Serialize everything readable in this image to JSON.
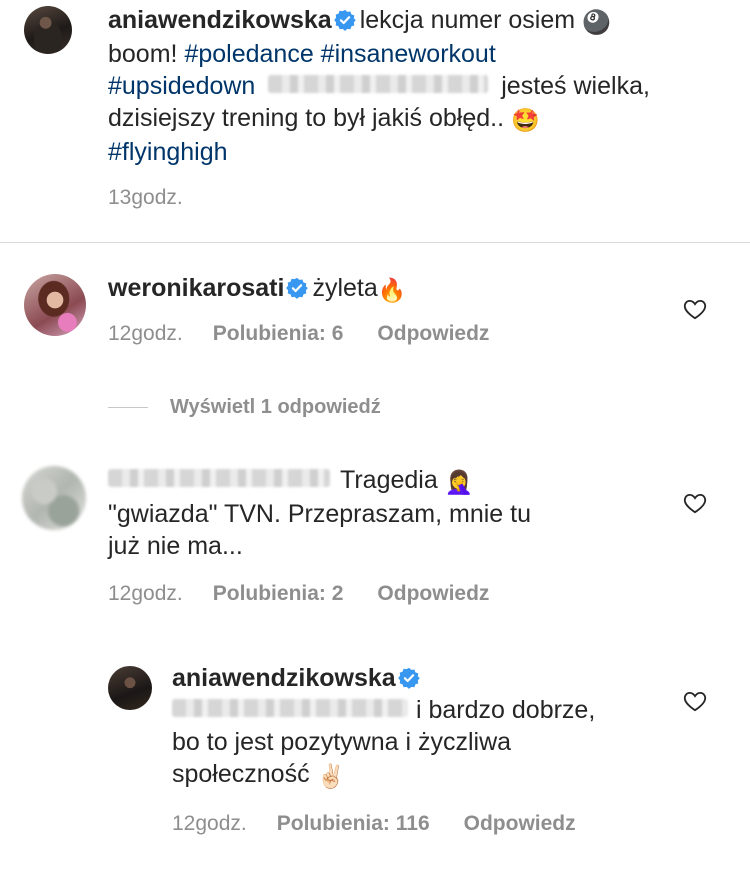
{
  "caption": {
    "username": "aniawendzikowska",
    "line1_text": "lekcja numer osiem",
    "line1_emoji": "🎱",
    "line2_text": "boom!",
    "hashtags_line2": "#poledance #insaneworkout",
    "hashtag_line3": "#upsidedown",
    "line3_text": "jesteś wielka,",
    "line4_text": "dzisiejszy trening to był jakiś obłęd..",
    "line4_emoji": "🤩",
    "hashtag_line5": "#flyinghigh",
    "time": "13godz."
  },
  "comments": [
    {
      "username": "weronikarosati",
      "text": "żyleta",
      "emoji": "🔥",
      "time": "12godz.",
      "likes": "Polubienia: 6",
      "reply": "Odpowiedz"
    },
    {
      "text_line1": "Tragedia",
      "emoji": "🤦‍♀️",
      "text_line2": "\"gwiazda\" TVN. Przepraszam, mnie tu",
      "text_line3": "już nie ma...",
      "time": "12godz.",
      "likes": "Polubienia: 2",
      "reply": "Odpowiedz"
    }
  ],
  "view_replies": "Wyświetl 1 odpowiedź",
  "reply": {
    "username": "aniawendzikowska",
    "text_line1": "i bardzo dobrze,",
    "text_line2": "bo to jest pozytywna i życzliwa",
    "text_line3": "społeczność",
    "emoji": "✌🏻",
    "time": "12godz.",
    "likes": "Polubienia: 116",
    "reply": "Odpowiedz"
  },
  "icons": {
    "verified": "verified-badge-icon",
    "heart": "heart-outline-icon"
  },
  "colors": {
    "verified_blue": "#3897f0",
    "hashtag": "#003569",
    "meta_gray": "#8e8e8e"
  }
}
